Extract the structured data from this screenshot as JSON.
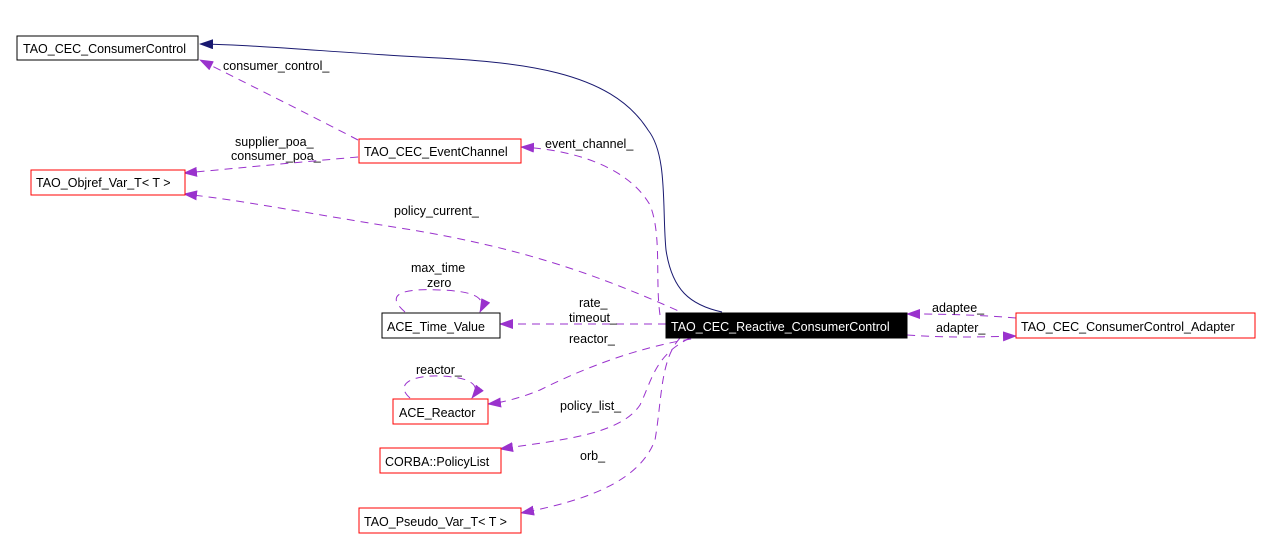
{
  "colors": {
    "inheritance_edge": "#191970",
    "usage_edge": "#9a32cd",
    "node_border_documented": "#000000",
    "node_border_undocumented": "#ff0000",
    "focus_node_fill": "#000000",
    "focus_node_text": "#ffffff"
  },
  "nodes": {
    "consumer_control": "TAO_CEC_ConsumerControl",
    "objref_var": "TAO_Objref_Var_T< T >",
    "event_channel": "TAO_CEC_EventChannel",
    "time_value": "ACE_Time_Value",
    "reactor": "ACE_Reactor",
    "policy_list": "CORBA::PolicyList",
    "pseudo_var": "TAO_Pseudo_Var_T< T >",
    "reactive_consumer_control": "TAO_CEC_Reactive_ConsumerControl",
    "consumer_control_adapter": "TAO_CEC_ConsumerControl_Adapter"
  },
  "edge_labels": {
    "consumer_control": "consumer_control_",
    "supplier_poa": "supplier_poa_",
    "consumer_poa": "consumer_poa_",
    "event_channel": "event_channel_",
    "policy_current": "policy_current_",
    "max_time": "max_time",
    "zero": "zero",
    "rate": "rate_",
    "timeout": "timeout_",
    "reactor_self": "reactor_",
    "reactor": "reactor_",
    "policy_list": "policy_list_",
    "orb": "orb_",
    "adaptee": "adaptee_",
    "adapter": "adapter_"
  }
}
